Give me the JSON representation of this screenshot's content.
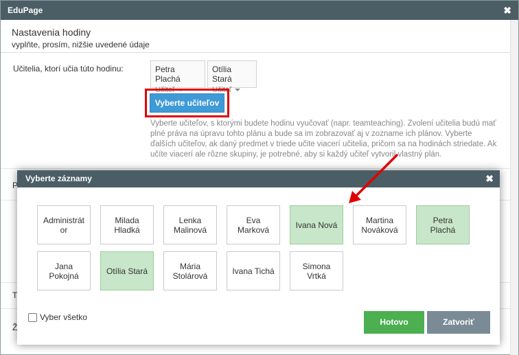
{
  "outer": {
    "window_title": "EduPage",
    "close_glyph": "✖",
    "title": "Nastavenia hodiny",
    "subtitle": "vyplňte, prosím, nižšie uvedené údaje",
    "teachers_label": "Učitelia, ktorí učia túto hodinu:",
    "teachers": [
      {
        "name": "Petra Plachá",
        "role": "Učiteľ"
      },
      {
        "name": "Otília Stará",
        "role": "Učiteľ"
      }
    ],
    "select_button": "Vyberte učiteľov",
    "help_text": "Vyberte učiteľov, s ktorými budete hodinu vyučovať (napr. teamteaching). Zvolení učitelia budú mať plné práva na úpravu tohto plánu a bude sa im zobrazovať aj v zozname ich plánov. Vyberte ďalších učiteľov, ak daný predmet v triede učite viacerí učitelia, pričom sa na hodinách striedate. Ak učíte viacerí ale rôzne skupiny, je potrebné, aby si každý učiteľ vytvoril vlastný plán.",
    "row_labels": [
      "P",
      "T",
      "Ž"
    ]
  },
  "modal": {
    "title": "Vyberte záznamy",
    "close_glyph": "✖",
    "items": [
      {
        "label": "Administrát or",
        "selected": false
      },
      {
        "label": "Milada Hladká",
        "selected": false
      },
      {
        "label": "Lenka Malinová",
        "selected": false
      },
      {
        "label": "Eva Marková",
        "selected": false
      },
      {
        "label": "Ivana Nová",
        "selected": true
      },
      {
        "label": "Martina Nováková",
        "selected": false
      },
      {
        "label": "Petra Plachá",
        "selected": true
      },
      {
        "label": "Jana Pokojná",
        "selected": false
      },
      {
        "label": "Otília Stará",
        "selected": true
      },
      {
        "label": "Mária Stolárová",
        "selected": false
      },
      {
        "label": "Ivana Tichá",
        "selected": false
      },
      {
        "label": "Simona Vrtká",
        "selected": false
      }
    ],
    "select_all_label": "Vyber všetko",
    "done_button": "Hotovo",
    "close_button": "Zatvoriť"
  },
  "colors": {
    "titlebar": "#4b5e66",
    "primary_button": "#3f9ad6",
    "highlight": "#e00000",
    "selected_tile": "#c8e6c9",
    "done_button": "#4caf50",
    "close_button": "#7a8b95"
  }
}
